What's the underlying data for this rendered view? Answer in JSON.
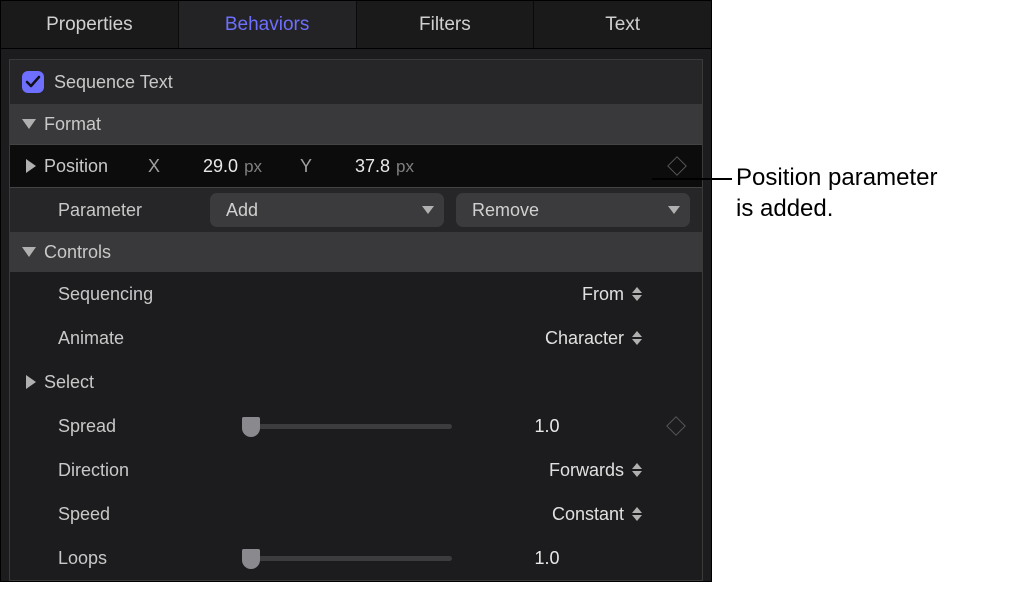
{
  "tabs": {
    "properties": "Properties",
    "behaviors": "Behaviors",
    "filters": "Filters",
    "text": "Text",
    "active": "behaviors"
  },
  "behavior": {
    "enabled": true,
    "title": "Sequence Text"
  },
  "sections": {
    "format": "Format",
    "controls": "Controls"
  },
  "format": {
    "position": {
      "label": "Position",
      "x_label": "X",
      "x_value": "29.0",
      "y_label": "Y",
      "y_value": "37.8",
      "unit": "px"
    },
    "parameter": {
      "label": "Parameter",
      "add": "Add",
      "remove": "Remove"
    }
  },
  "controls": {
    "sequencing": {
      "label": "Sequencing",
      "value": "From"
    },
    "animate": {
      "label": "Animate",
      "value": "Character"
    },
    "select": {
      "label": "Select"
    },
    "spread": {
      "label": "Spread",
      "value": "1.0"
    },
    "direction": {
      "label": "Direction",
      "value": "Forwards"
    },
    "speed": {
      "label": "Speed",
      "value": "Constant"
    },
    "loops": {
      "label": "Loops",
      "value": "1.0"
    }
  },
  "annotation": {
    "line1": "Position parameter",
    "line2": "is added."
  }
}
